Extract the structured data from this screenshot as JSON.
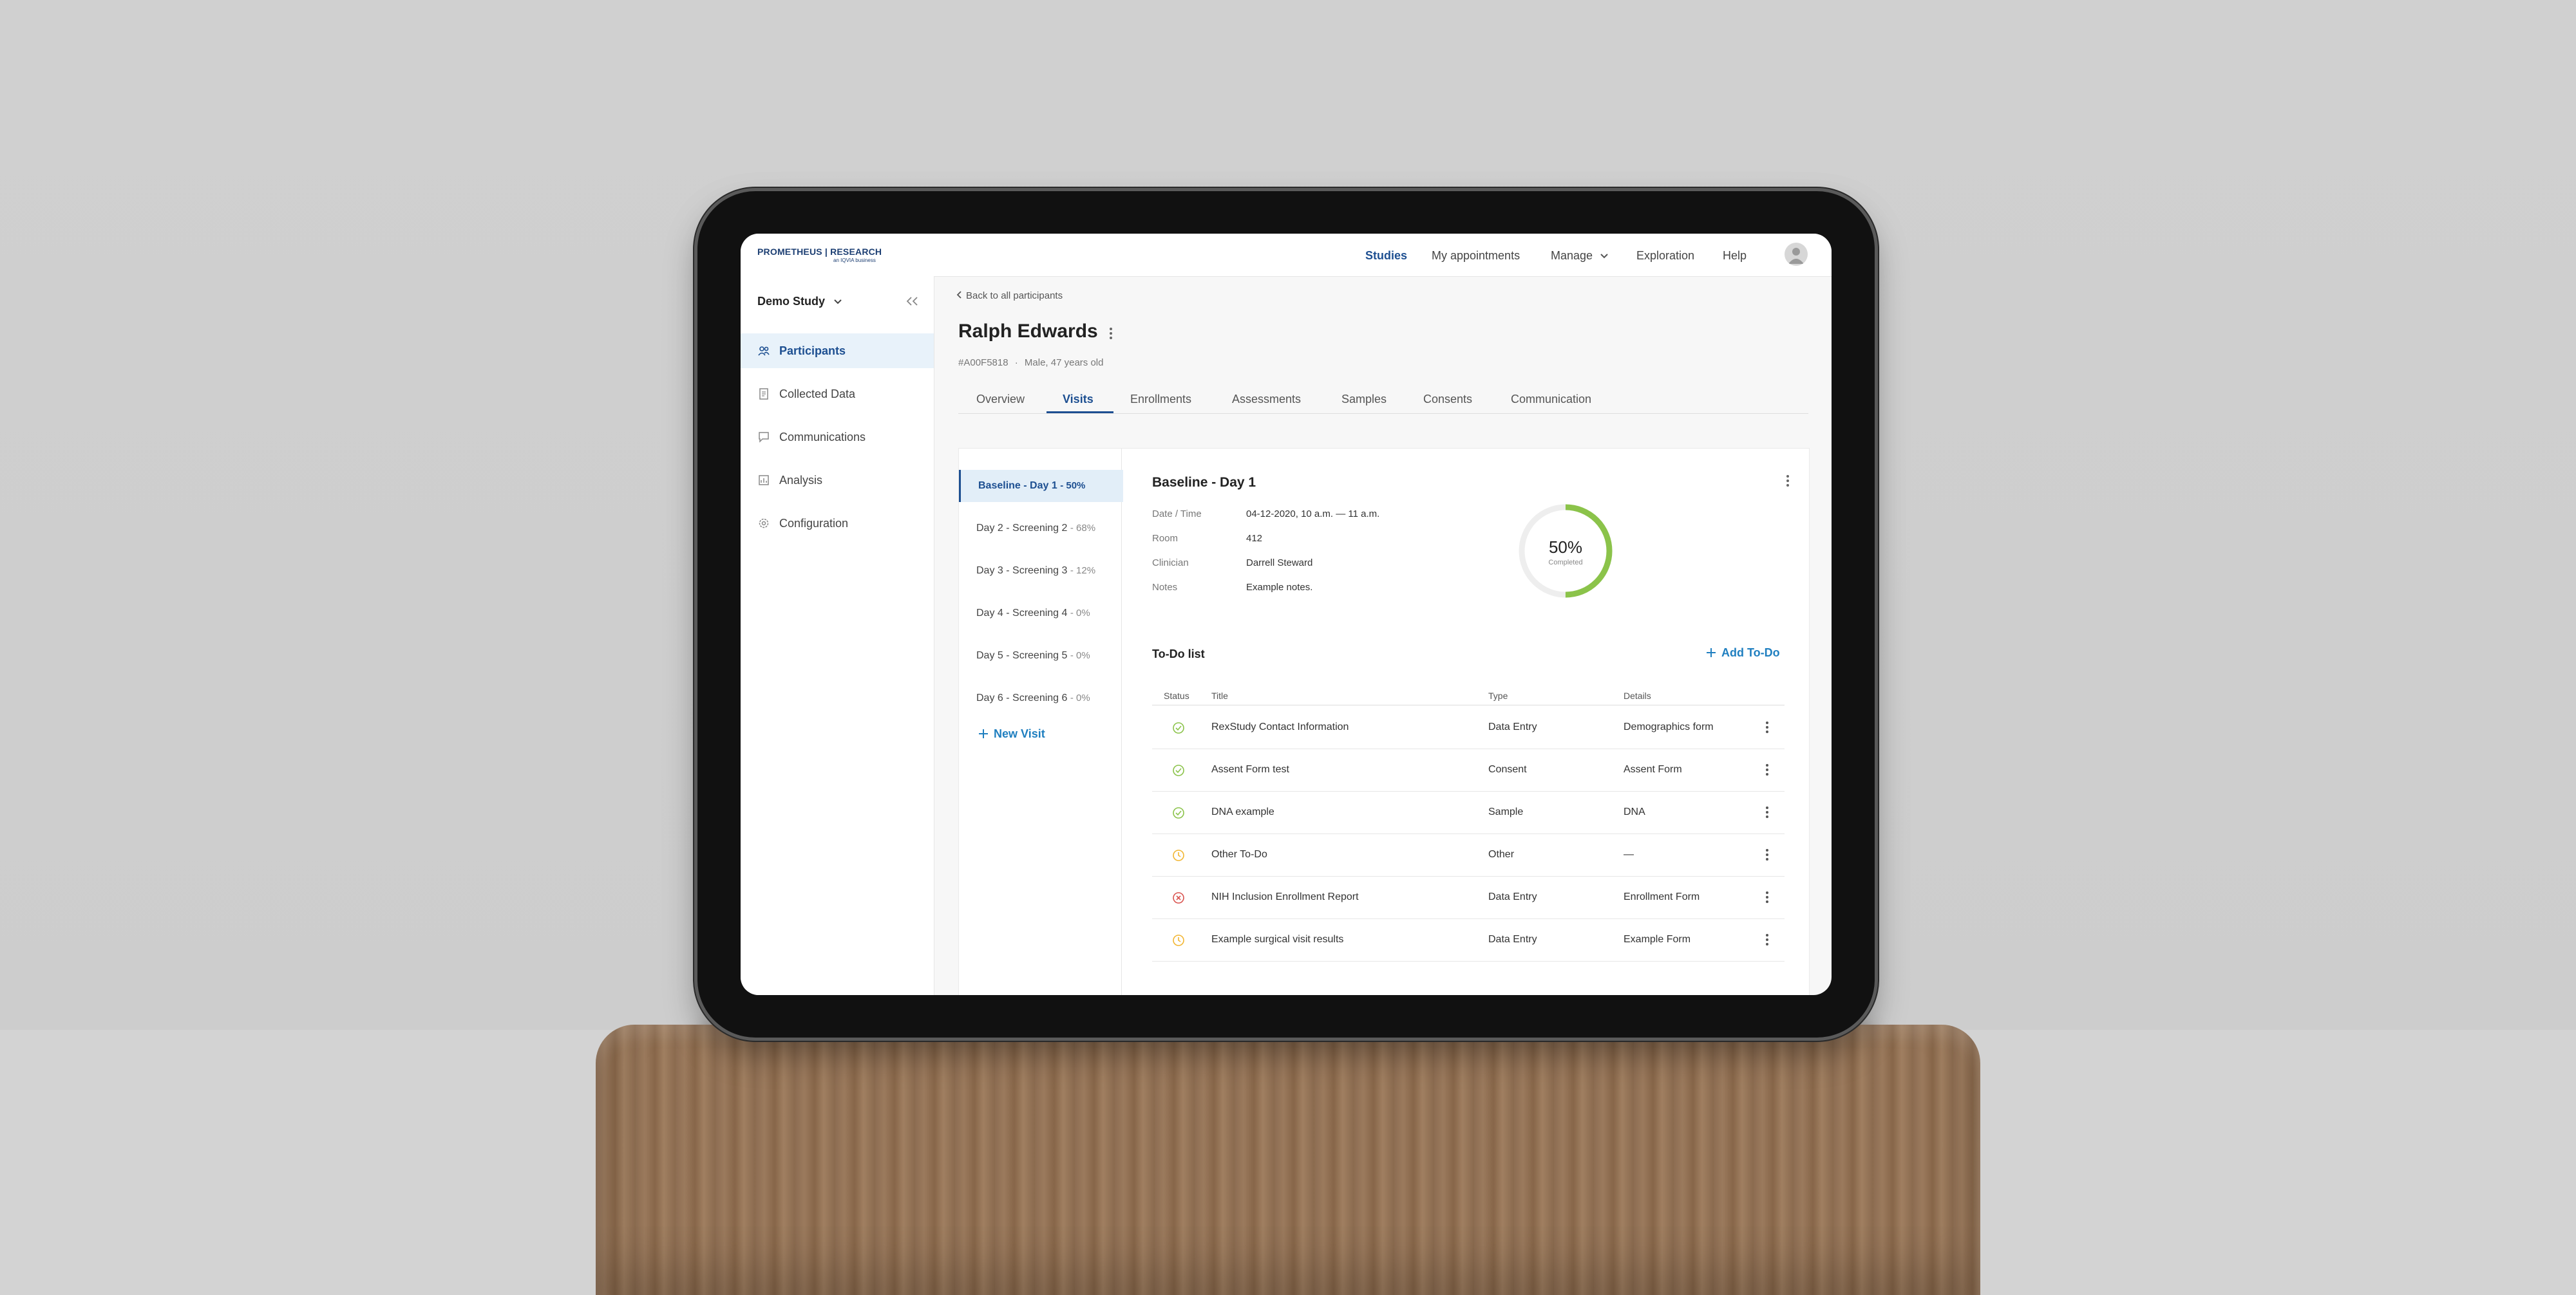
{
  "header": {
    "logo": "PROMETHEUS | RESEARCH",
    "logo_sub": "an IQVIA business",
    "nav": [
      "Studies",
      "My appointments",
      "Manage",
      "Exploration",
      "Help"
    ]
  },
  "sidebar": {
    "study": "Demo Study",
    "items": [
      {
        "label": "Participants",
        "icon": "participants-icon"
      },
      {
        "label": "Collected Data",
        "icon": "document-icon"
      },
      {
        "label": "Communications",
        "icon": "chat-icon"
      },
      {
        "label": "Analysis",
        "icon": "chart-icon"
      },
      {
        "label": "Configuration",
        "icon": "gear-icon"
      }
    ]
  },
  "participant": {
    "back": "Back to all participants",
    "name": "Ralph Edwards",
    "id": "#A00F5818",
    "info": "Male, 47 years old"
  },
  "tabs": [
    "Overview",
    "Visits",
    "Enrollments",
    "Assessments",
    "Samples",
    "Consents",
    "Communication"
  ],
  "visits": [
    {
      "label": "Baseline - Day 1",
      "pct": "- 50%"
    },
    {
      "label": "Day 2 - Screening 2",
      "pct": "- 68%"
    },
    {
      "label": "Day 3 - Screening 3",
      "pct": "- 12%"
    },
    {
      "label": "Day 4 - Screening 4",
      "pct": "- 0%"
    },
    {
      "label": "Day 5 - Screening 5",
      "pct": "- 0%"
    },
    {
      "label": "Day 6 - Screening 6",
      "pct": "- 0%"
    }
  ],
  "new_visit": "New Visit",
  "visit_detail": {
    "title": "Baseline - Day 1",
    "fields": [
      {
        "label": "Date / Time",
        "value": "04-12-2020, 10 a.m. — 11 a.m."
      },
      {
        "label": "Room",
        "value": "412"
      },
      {
        "label": "Clinician",
        "value": "Darrell Steward"
      },
      {
        "label": "Notes",
        "value": "Example notes."
      }
    ],
    "progress": 0.5,
    "progress_text": "50%",
    "progress_label": "Completed",
    "accent": "#8bc34a"
  },
  "todo": {
    "heading": "To-Do list",
    "add": "Add To-Do",
    "columns": [
      "Status",
      "Title",
      "Type",
      "Details"
    ],
    "rows": [
      {
        "status": "complete",
        "title": "RexStudy Contact Information",
        "type": "Data Entry",
        "details": "Demographics form"
      },
      {
        "status": "complete",
        "title": "Assent Form test",
        "type": "Consent",
        "details": "Assent Form"
      },
      {
        "status": "complete",
        "title": "DNA example",
        "type": "Sample",
        "details": "DNA"
      },
      {
        "status": "pending",
        "title": "Other To-Do",
        "type": "Other",
        "details": "—"
      },
      {
        "status": "failed",
        "title": "NIH Inclusion Enrollment Report",
        "type": "Data Entry",
        "details": "Enrollment Form"
      },
      {
        "status": "pending",
        "title": "Example surgical visit results",
        "type": "Data Entry",
        "details": "Example Form"
      }
    ],
    "status_colors": {
      "complete": "#8bc34a",
      "pending": "#f2b632",
      "failed": "#d9534f"
    }
  }
}
